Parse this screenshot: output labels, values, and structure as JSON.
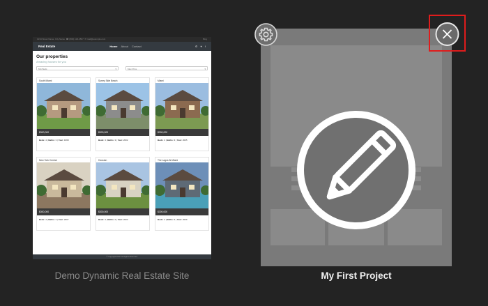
{
  "cards": [
    {
      "caption": "Demo Dynamic Real Estate Site",
      "thumbnail": {
        "topbar": {
          "left": "1234 Street Name, City Name",
          "phone": "☎ (800) 123-4567",
          "email": "✉ mail@example.com",
          "right": "Blog"
        },
        "nav": {
          "brand": "Real Estate",
          "links": [
            "Home",
            "About",
            "Contact"
          ],
          "social": [
            "⚙",
            "♥",
            "f"
          ]
        },
        "heading": "Our properties",
        "subheading": "Amazing houses for you",
        "filters": [
          "Min Beds",
          "Max Price"
        ],
        "listings": [
          {
            "title": "South Miami",
            "price": "$300,000",
            "beds": "4",
            "baths": "3",
            "year": "1998"
          },
          {
            "title": "Surrey Side Beach",
            "price": "$300,000",
            "beds": "3",
            "baths": "3",
            "year": "2002"
          },
          {
            "title": "Miami",
            "price": "$300,000",
            "beds": "4",
            "baths": "3",
            "year": "2005"
          },
          {
            "title": "New York Central",
            "price": "$300,000",
            "beds": "4",
            "baths": "3",
            "year": "2007"
          },
          {
            "title": "Houston",
            "price": "$300,000",
            "beds": "3",
            "baths": "2",
            "year": "2003"
          },
          {
            "title": "The Lagos At Miami",
            "price": "$300,000",
            "beds": "4",
            "baths": "3",
            "year": "2009"
          }
        ],
        "labels": {
          "beds": "Beds:",
          "baths": "Baths:",
          "year": "Year:"
        },
        "footer": "© Copyright 2018. All Rights Reserved."
      }
    },
    {
      "caption": "My First Project"
    }
  ],
  "icons": {
    "settings": "gear-icon",
    "close": "close-icon",
    "edit": "pencil-icon"
  },
  "colors": {
    "background": "#232323",
    "project_placeholder": "#7a7a7a",
    "close_highlight": "#e01c1c"
  }
}
